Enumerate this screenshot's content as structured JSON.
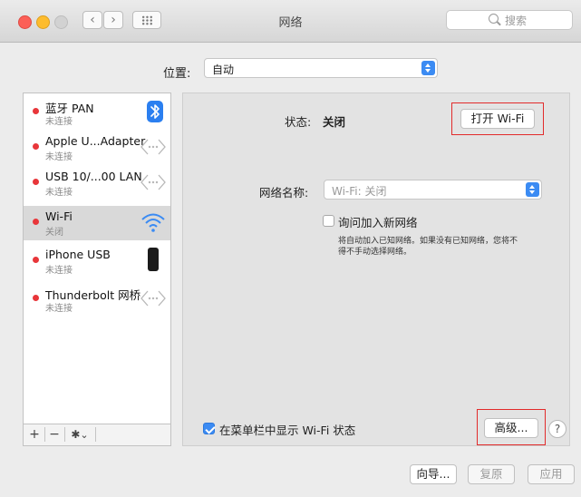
{
  "window": {
    "title": "网络"
  },
  "titlebar": {
    "search_placeholder": "搜索",
    "back": "‹",
    "forward": "›"
  },
  "location": {
    "label": "位置:",
    "value": "自动"
  },
  "services": [
    {
      "name": "蓝牙 PAN",
      "status": "未连接",
      "icon": "bluetooth-icon",
      "status_color": "#e8363a"
    },
    {
      "name": "Apple U...Adapter",
      "status": "未连接",
      "icon": "ethernet-icon",
      "status_color": "#e8363a"
    },
    {
      "name": "USB 10/...00 LAN",
      "status": "未连接",
      "icon": "ethernet-icon",
      "status_color": "#e8363a"
    },
    {
      "name": "Wi-Fi",
      "status": "关闭",
      "icon": "wifi-icon",
      "status_color": "#e8363a",
      "selected": true
    },
    {
      "name": "iPhone USB",
      "status": "未连接",
      "icon": "iphone-icon",
      "status_color": "#e8363a"
    },
    {
      "name": "Thunderbolt 网桥",
      "status": "未连接",
      "icon": "ethernet-icon",
      "status_color": "#e8363a"
    }
  ],
  "sidebar_footer": {
    "add": "+",
    "remove": "−",
    "gear": "✱",
    "caret": "⌄"
  },
  "detail": {
    "status_label": "状态:",
    "status_value": "关闭",
    "turn_on_button": "打开 Wi-Fi",
    "network_name_label": "网络名称:",
    "network_name_value": "Wi-Fi: 关闭",
    "ask_join_label": "询问加入新网络",
    "ask_join_checked": false,
    "ask_join_desc_1": "将自动加入已知网络。如果没有已知网络，您将不",
    "ask_join_desc_2": "得不手动选择网络。",
    "show_in_menubar_label": "在菜单栏中显示 Wi-Fi 状态",
    "show_in_menubar_checked": true,
    "advanced_button": "高级...",
    "help_button": "?"
  },
  "footer": {
    "assist_button": "向导...",
    "revert_button": "复原",
    "apply_button": "应用"
  },
  "colors": {
    "accent": "#3b8bf3",
    "highlight_box": "#e22b2b"
  }
}
